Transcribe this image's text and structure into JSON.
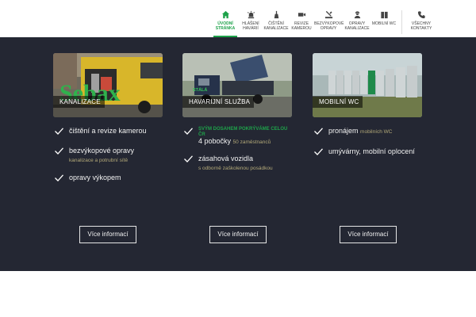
{
  "nav": {
    "items": [
      {
        "label": "ÚVODNÍ STRÁNKA",
        "icon": "home-icon",
        "active": true
      },
      {
        "label": "HLÁŠENÍ HAVÁRIÍ",
        "icon": "alarm-icon",
        "active": false
      },
      {
        "label": "ČIŠTĚNÍ KANALIZACE",
        "icon": "cleaning-icon",
        "active": false
      },
      {
        "label": "REVIZE KAMEROU",
        "icon": "camera-icon",
        "active": false
      },
      {
        "label": "BEZVÝKOPOVÉ OPRAVY",
        "icon": "repair-icon",
        "active": false
      },
      {
        "label": "OPRAVY KANALIZACE",
        "icon": "worker-icon",
        "active": false
      },
      {
        "label": "MOBILNÍ WC",
        "icon": "toilet-icon",
        "active": false
      },
      {
        "label": "VŠECHNY KONTAKTY",
        "icon": "phone-icon",
        "active": false
      }
    ],
    "accent": "#1ea24a"
  },
  "columns": [
    {
      "photo_tag": "KANALIZACE",
      "logo_text": "Sebax",
      "items": [
        {
          "main": "čištění a revize kamerou",
          "sub": ""
        },
        {
          "main": "bezvýkopové opravy",
          "sub": "kanalizace a potrubní sítě"
        },
        {
          "main": "opravy výkopem",
          "sub": ""
        }
      ],
      "button": "Více informací"
    },
    {
      "photo_sub": "STÁLÁ",
      "photo_tag": "HAVARIJNÍ SLUŽBA",
      "items": [
        {
          "green": "SVÝM DOSAHEM POKRÝVÁME CELOU ČR",
          "main": "4 pobočky",
          "sub": "50 zaměstnanců"
        },
        {
          "main": "zásahová vozidla",
          "sub": "s odborně zaškolenou posádkou"
        }
      ],
      "button": "Více informací"
    },
    {
      "photo_tag": "MOBILNÍ WC",
      "items": [
        {
          "main": "pronájem",
          "sub": "mobilních WC"
        },
        {
          "main": "umývárny, mobilní oplocení",
          "sub": ""
        }
      ],
      "button": "Více informací"
    }
  ],
  "colors": {
    "dark_bg": "#242733",
    "accent": "#1ea24a",
    "muted": "#b3a978"
  }
}
